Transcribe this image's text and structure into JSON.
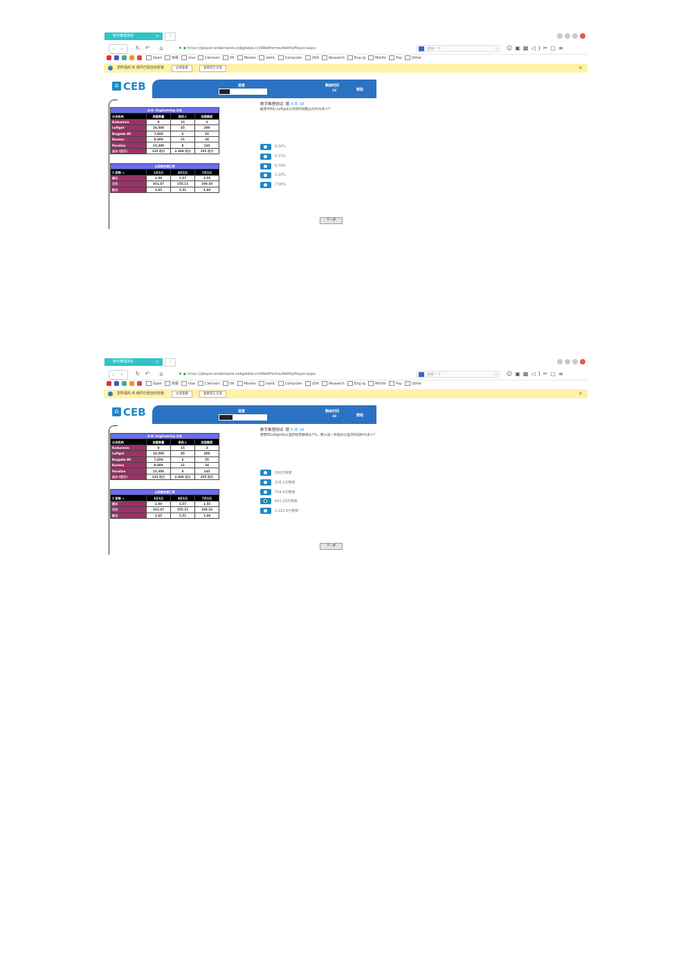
{
  "browser": {
    "tab_title": "数字推理测试",
    "tab_close": "×",
    "new_tab": "⁝",
    "url_scheme": "https",
    "url_rest": "://player.ondemand.cebglobal.cn/WebForms/AbilityPlayer.aspx",
    "search_placeholder": "搜索一下",
    "bookmarks": [
      "Open",
      "简报",
      "visa",
      "Clemson",
      "VR",
      "Movies",
      "static",
      "Computer",
      "USA",
      "Research",
      "Eng rg",
      "Motihr",
      "Pay",
      "Other"
    ],
    "notice_text": "您所需的 IE 组件已经自动安装",
    "notice_btn1": "立即查看",
    "notice_btn2": "查看其它方案",
    "notice_close": "×"
  },
  "page": {
    "logo": "CEB",
    "progress_label": "进度",
    "time_label": "剩余时间",
    "time_value": "24",
    "help_label": "帮助",
    "next_label": "下一步",
    "table1": {
      "caption": "A.N. Engineering 分支",
      "headers": [
        "分支机构",
        "房屋数量",
        "职员人",
        "经营额度"
      ],
      "rows": [
        [
          "Kaduzenia",
          "0",
          "15",
          "3"
        ],
        [
          "Luftgut",
          "10,500",
          "45",
          "200"
        ],
        [
          "Brygade AV",
          "7,450",
          "6",
          "55"
        ],
        [
          "Kuseno",
          "9,400",
          "21",
          "34"
        ],
        [
          "Pacelise",
          "15,300",
          "8",
          "145"
        ],
        [
          "总计 (百万)",
          "125 百万",
          "2,300 百万",
          "255 百万"
        ]
      ]
    },
    "table2": {
      "caption": "从英镑兑换汇率",
      "headers": [
        "1 英镑 =",
        "1月1日",
        "4月1日",
        "7月1日"
      ],
      "rows": [
        [
          "美元",
          "1.50",
          "1.57",
          "1.55"
        ],
        [
          "日元",
          "161.47",
          "155.11",
          "168.33"
        ],
        [
          "欧元",
          "1.65",
          "1.51",
          "1.60"
        ]
      ]
    }
  },
  "screens": [
    {
      "question_prefix": "数字推理测试: 题",
      "question_num": "4 共 18",
      "question_text": "截至4月份 Luftgut公司的利润额占比约为多少?",
      "options": [
        "6.00%",
        "0.11%",
        "0.79%",
        "1.10%",
        "7.56%"
      ],
      "selected_index": -1,
      "progress_fraction": 0.22
    },
    {
      "question_prefix": "数字推理测试: 题",
      "question_num": "5 共 18",
      "question_text": "若明年Luftgut办公室的经营额增长7%，那么该一年度办公室的利润约为多少?",
      "options": [
        "290万英镑",
        "316.2万英镑",
        "734.4万英镑",
        "641.20万英镑",
        "1,222.8万英镑"
      ],
      "selected_index": 3,
      "progress_fraction": 0.28
    }
  ]
}
